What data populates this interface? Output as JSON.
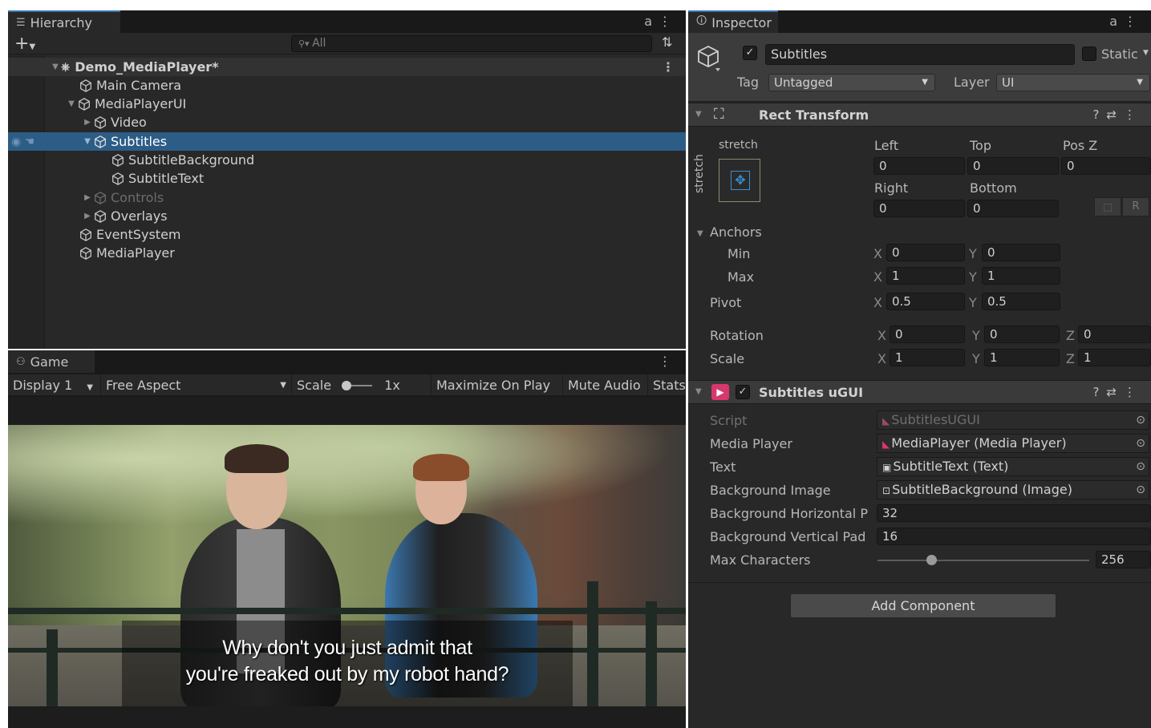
{
  "hierarchy": {
    "tab_label": "Hierarchy",
    "add_label": "+",
    "search_placeholder": "All",
    "scene_name": "Demo_MediaPlayer*",
    "items": [
      {
        "label": "Main Camera"
      },
      {
        "label": "MediaPlayerUI"
      },
      {
        "label": "Video"
      },
      {
        "label": "Subtitles"
      },
      {
        "label": "SubtitleBackground"
      },
      {
        "label": "SubtitleText"
      },
      {
        "label": "Controls"
      },
      {
        "label": "Overlays"
      },
      {
        "label": "EventSystem"
      },
      {
        "label": "MediaPlayer"
      }
    ]
  },
  "game": {
    "tab_label": "Game",
    "display": "Display 1",
    "aspect": "Free Aspect",
    "scale_label": "Scale",
    "scale_value": "1x",
    "maximize": "Maximize On Play",
    "mute": "Mute Audio",
    "stats": "Stats",
    "subtitle_line1": "Why don't you just admit that",
    "subtitle_line2": "you're freaked out by my robot hand?"
  },
  "inspector": {
    "tab_label": "Inspector",
    "object_name": "Subtitles",
    "static_label": "Static",
    "tag_label": "Tag",
    "tag_value": "Untagged",
    "layer_label": "Layer",
    "layer_value": "UI",
    "rect_transform": {
      "title": "Rect Transform",
      "stretch_h": "stretch",
      "stretch_v": "stretch",
      "left_label": "Left",
      "top_label": "Top",
      "posz_label": "Pos Z",
      "left": "0",
      "top": "0",
      "posz": "0",
      "right_label": "Right",
      "bottom_label": "Bottom",
      "right": "0",
      "bottom": "0",
      "r_button": "R",
      "anchors_label": "Anchors",
      "min_label": "Min",
      "max_label": "Max",
      "pivot_label": "Pivot",
      "rotation_label": "Rotation",
      "scale_label": "Scale",
      "anchor_min_x": "0",
      "anchor_min_y": "0",
      "anchor_max_x": "1",
      "anchor_max_y": "1",
      "pivot_x": "0.5",
      "pivot_y": "0.5",
      "rot_x": "0",
      "rot_y": "0",
      "rot_z": "0",
      "scale_x": "1",
      "scale_y": "1",
      "scale_z": "1"
    },
    "subtitles_ugui": {
      "title": "Subtitles uGUI",
      "script_label": "Script",
      "script_value": "SubtitlesUGUI",
      "media_player_label": "Media Player",
      "media_player_value": "MediaPlayer (Media Player)",
      "text_label": "Text",
      "text_value": "SubtitleText (Text)",
      "bg_image_label": "Background Image",
      "bg_image_value": "SubtitleBackground (Image)",
      "bg_hpad_label": "Background Horizontal P",
      "bg_hpad_value": "32",
      "bg_vpad_label": "Background Vertical Pad",
      "bg_vpad_value": "16",
      "max_chars_label": "Max Characters",
      "max_chars_value": "256"
    },
    "add_component": "Add Component"
  },
  "colors": {
    "selection": "#2c5d87",
    "panel": "#282828",
    "accent": "#3a72b0"
  }
}
